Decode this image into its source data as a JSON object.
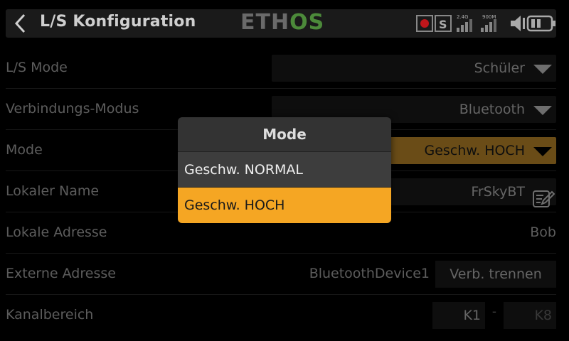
{
  "header": {
    "title": "L/S Konfiguration",
    "logo_left": "ETH",
    "logo_right": "OS",
    "signal_label_24": "2.4G",
    "signal_label_900": "900M",
    "rf_letter": "S"
  },
  "rows": [
    {
      "label": "L/S Mode",
      "value": "Schüler"
    },
    {
      "label": "Verbindungs-Modus",
      "value": "Bluetooth"
    },
    {
      "label": "Mode",
      "value": "Geschw. HOCH"
    },
    {
      "label": "Lokaler Name",
      "value": "FrSkyBT"
    },
    {
      "label": "Lokale Adresse",
      "value": "Bob"
    },
    {
      "label": "Externe Adresse",
      "value": "BluetoothDevice1",
      "button": "Verb. trennen"
    },
    {
      "label": "Kanalbereich",
      "from": "K1",
      "sep": "-",
      "to": "K8"
    }
  ],
  "popup": {
    "title": "Mode",
    "options": [
      "Geschw. NORMAL",
      "Geschw. HOCH"
    ],
    "selected": "Geschw. HOCH"
  },
  "colors": {
    "accent": "#f5a623",
    "logo_green": "#4c8a3a"
  },
  "icons": [
    "back-arrow-icon",
    "record-icon",
    "rf-icon",
    "signal-bars-icon",
    "speaker-mute-icon",
    "battery-icon",
    "dropdown-caret-icon",
    "edit-icon"
  ]
}
